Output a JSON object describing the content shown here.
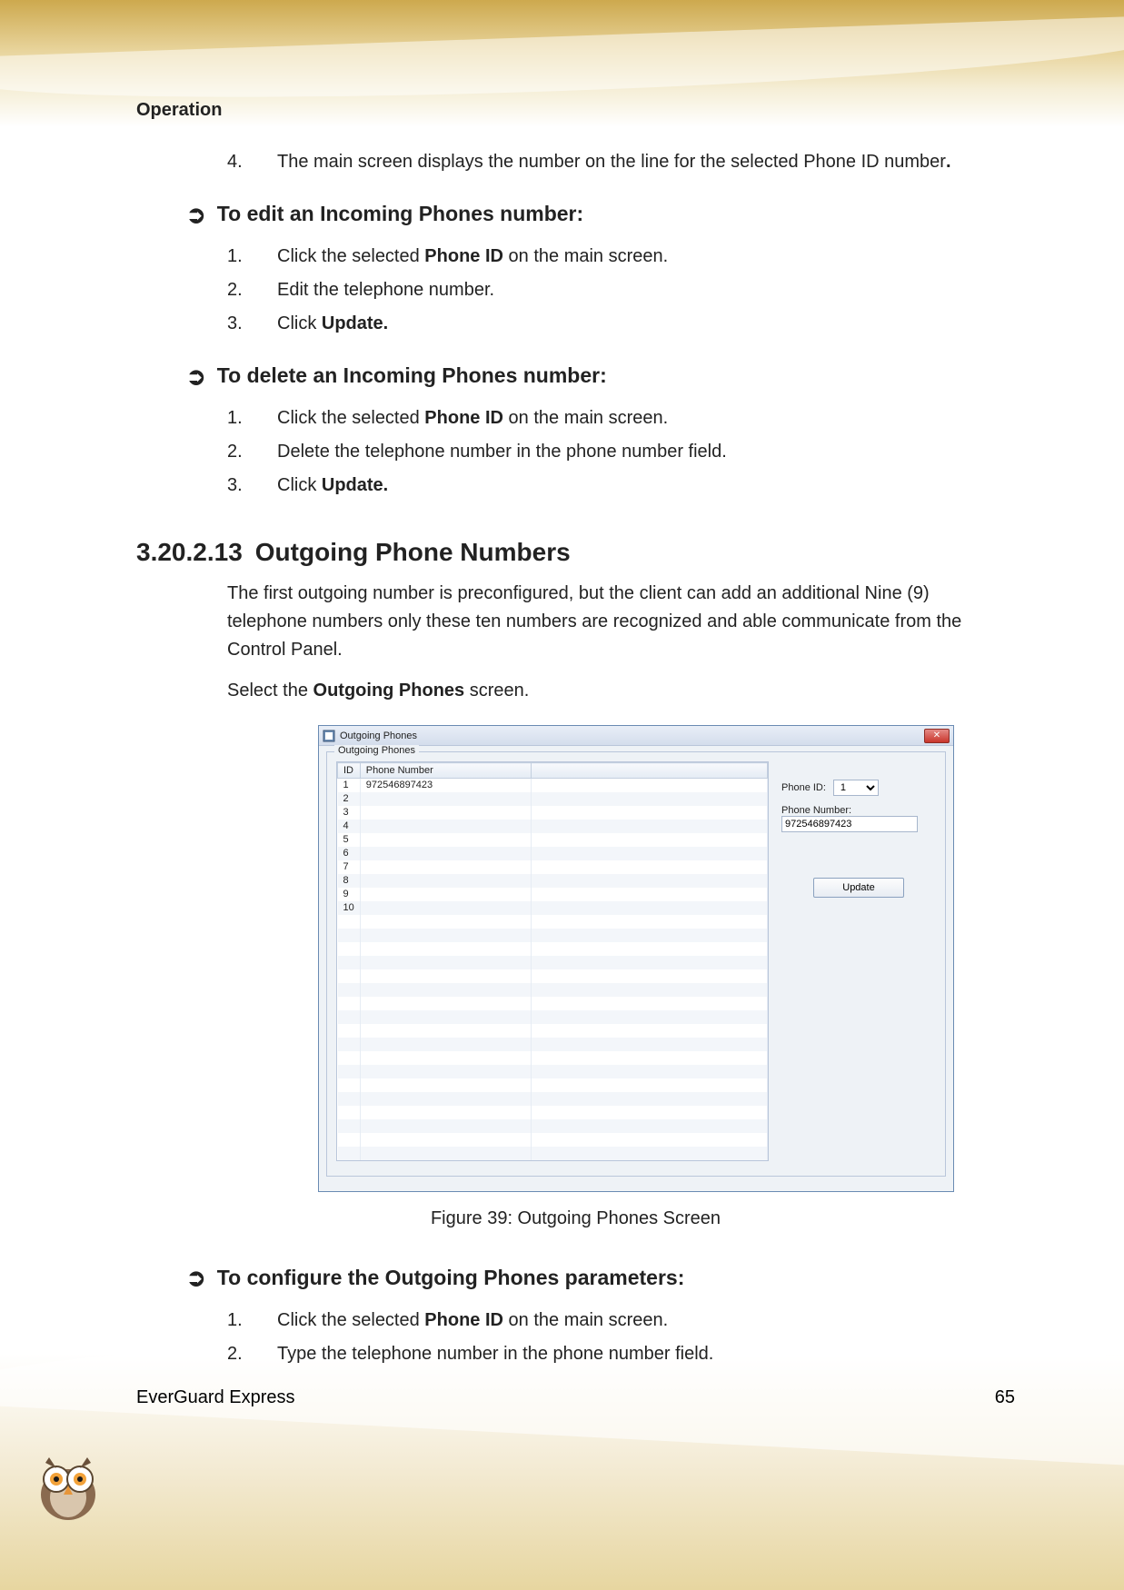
{
  "header": {
    "title": "Operation"
  },
  "step4": {
    "num": "4.",
    "text_a": "The main screen displays the number on the line for the selected Phone ID number",
    "text_b": "."
  },
  "edit_heading": "To edit an Incoming Phones number:",
  "edit_steps": [
    {
      "num": "1.",
      "pre": "Click the selected ",
      "bold": "Phone ID",
      "post": " on the main screen."
    },
    {
      "num": "2.",
      "pre": "Edit the telephone number.",
      "bold": "",
      "post": ""
    },
    {
      "num": "3.",
      "pre": "Click ",
      "bold": "Update.",
      "post": ""
    }
  ],
  "delete_heading": "To delete an Incoming Phones number:",
  "delete_steps": [
    {
      "num": "1.",
      "pre": "Click the selected ",
      "bold": "Phone ID",
      "post": " on the main screen."
    },
    {
      "num": "2.",
      "pre": "Delete the telephone number in the phone number field.",
      "bold": "",
      "post": ""
    },
    {
      "num": "3.",
      "pre": "Click ",
      "bold": "Update.",
      "post": ""
    }
  ],
  "section": {
    "num": "3.20.2.13",
    "title": "Outgoing Phone Numbers"
  },
  "para1": "The first outgoing number is preconfigured, but the client can add an additional Nine (9) telephone numbers only these ten numbers are recognized and able communicate from the Control Panel.",
  "para2_pre": "Select the ",
  "para2_bold": "Outgoing Phones",
  "para2_post": " screen.",
  "dialog": {
    "title": "Outgoing Phones",
    "group_title": "Outgoing Phones",
    "columns": {
      "id": "ID",
      "phone": "Phone Number"
    },
    "rows": [
      {
        "id": "1",
        "phone": "972546897423"
      },
      {
        "id": "2",
        "phone": ""
      },
      {
        "id": "3",
        "phone": ""
      },
      {
        "id": "4",
        "phone": ""
      },
      {
        "id": "5",
        "phone": ""
      },
      {
        "id": "6",
        "phone": ""
      },
      {
        "id": "7",
        "phone": ""
      },
      {
        "id": "8",
        "phone": ""
      },
      {
        "id": "9",
        "phone": ""
      },
      {
        "id": "10",
        "phone": ""
      }
    ],
    "blank_rows": 18,
    "phone_id_label": "Phone ID:",
    "phone_id_value": "1",
    "phone_number_label": "Phone Number:",
    "phone_number_value": "972546897423",
    "update_label": "Update",
    "close_glyph": "✕"
  },
  "figure_caption": "Figure 39: Outgoing Phones Screen",
  "configure_heading": "To configure the Outgoing Phones parameters:",
  "configure_steps": [
    {
      "num": "1.",
      "pre": "Click the selected ",
      "bold": "Phone ID",
      "post": " on the main screen."
    },
    {
      "num": "2.",
      "pre": "Type the telephone number in the phone number field.",
      "bold": "",
      "post": ""
    }
  ],
  "footer": {
    "product": "EverGuard Express",
    "page": "65"
  }
}
